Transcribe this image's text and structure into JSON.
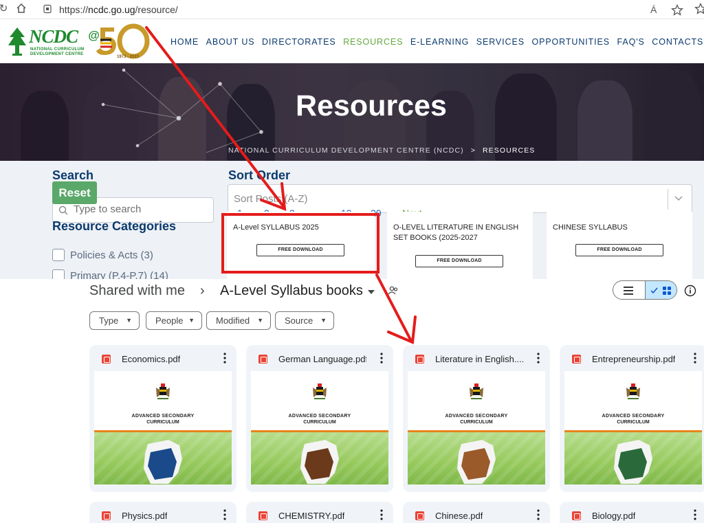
{
  "browser": {
    "url_scheme": "https://",
    "url_host": "ncdc.go.ug",
    "url_path": "/resource/",
    "read_aloud_label": "Á"
  },
  "site": {
    "logo_text": "NCDC",
    "logo_at": "@",
    "logo_sub1": "NATIONAL CURRICULUM",
    "logo_sub2": "DEVELOPMENT CENTRE",
    "logo_years": "1973 - 2023",
    "nav": [
      {
        "label": "HOME"
      },
      {
        "label": "ABOUT US"
      },
      {
        "label": "DIRECTORATES"
      },
      {
        "label": "RESOURCES"
      },
      {
        "label": "E-LEARNING"
      },
      {
        "label": "SERVICES"
      },
      {
        "label": "OPPORTUNITIES"
      },
      {
        "label": "FAQ'S"
      },
      {
        "label": "CONTACTS"
      }
    ],
    "active_nav": "RESOURCES",
    "hero_title": "Resources",
    "breadcrumb_home": "NATIONAL CURRICULUM DEVELOPMENT CENTRE (NCDC)",
    "breadcrumb_sep": ">",
    "breadcrumb_current": "RESOURCES"
  },
  "filters": {
    "search_title": "Search",
    "reset_label": "Reset",
    "search_placeholder": "Type to search",
    "categories_title": "Resource Categories",
    "categories": [
      {
        "label": "Policies & Acts (3)"
      },
      {
        "label": "Primary (P.4-P.7) (14)"
      }
    ],
    "sort_title": "Sort Order",
    "sort_value": "Sort Posts (A-Z)",
    "pagination": [
      "1",
      "2",
      "3",
      "19",
      "20"
    ],
    "pagination_next": "Next"
  },
  "resource_cards": [
    {
      "title": "A-Level SYLLABUS 2025",
      "button": "FREE DOWNLOAD"
    },
    {
      "title": "O-LEVEL LITERATURE IN ENGLISH SET BOOKS (2025-2027",
      "button": "FREE DOWNLOAD"
    },
    {
      "title": "CHINESE SYLLABUS",
      "button": "FREE DOWNLOAD"
    }
  ],
  "drive": {
    "crumb_root": "Shared with me",
    "crumb_sep": "›",
    "crumb_folder": "A-Level Syllabus books",
    "chips": [
      {
        "label": "Type"
      },
      {
        "label": "People"
      },
      {
        "label": "Modified"
      },
      {
        "label": "Source"
      }
    ],
    "thumb_line1": "ADVANCED SECONDARY",
    "thumb_line2": "CURRICULUM",
    "files": [
      {
        "name": "Economics.pdf"
      },
      {
        "name": "German Language.pdf"
      },
      {
        "name": "Literature in English...."
      },
      {
        "name": "Entrepreneurship.pdf"
      },
      {
        "name": "Physics.pdf"
      },
      {
        "name": "CHEMISTRY.pdf"
      },
      {
        "name": "Chinese.pdf"
      },
      {
        "name": "Biology.pdf"
      }
    ]
  },
  "colors": {
    "brand_green": "#1e8a2e",
    "nav_blue": "#0b3a6d",
    "nav_active": "#62a83c",
    "annotation_red": "#e51b1b"
  }
}
